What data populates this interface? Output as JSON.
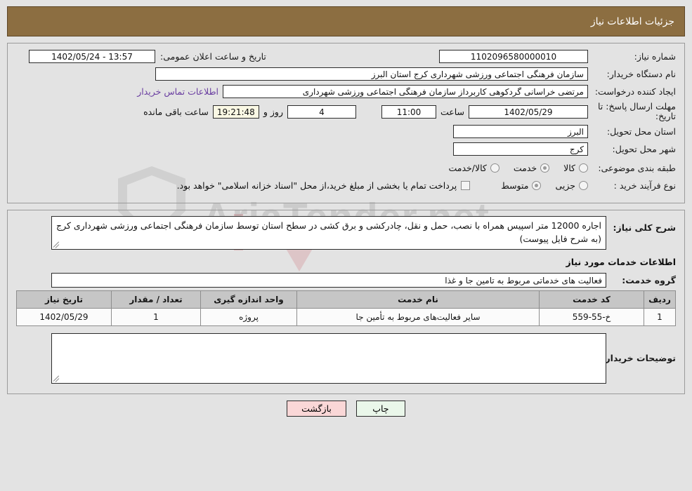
{
  "header": {
    "title": "جزئیات اطلاعات نیاز"
  },
  "watermark": {
    "text": "AriaTender.net"
  },
  "form": {
    "need_number_label": "شماره نیاز:",
    "need_number_value": "1102096580000010",
    "announce_label": "تاریخ و ساعت اعلان عمومی:",
    "announce_value": "13:57 - 1402/05/24",
    "buyer_org_label": "نام دستگاه خریدار:",
    "buyer_org_value": "سازمان فرهنگی اجتماعی ورزشی شهرداری کرج استان البرز",
    "creator_label": "ایجاد کننده درخواست:",
    "creator_value": "مرتضی خراسانی گردکوهی کاربرداز سازمان فرهنگی اجتماعی ورزشی شهرداری",
    "contact_link": "اطلاعات تماس خریدار",
    "deadline_label": "مهلت ارسال پاسخ: تا تاریخ:",
    "deadline_date": "1402/05/29",
    "hour_label": "ساعت",
    "deadline_hour": "11:00",
    "days_value": "4",
    "days_label": "روز و",
    "countdown_value": "19:21:48",
    "remaining_label": "ساعت باقی مانده",
    "province_label": "استان محل تحویل:",
    "province_value": "البرز",
    "city_label": "شهر محل تحویل:",
    "city_value": "کرج",
    "category_label": "طبقه بندی موضوعی:",
    "category_options": [
      {
        "label": "کالا",
        "selected": false
      },
      {
        "label": "خدمت",
        "selected": true
      },
      {
        "label": "کالا/خدمت",
        "selected": false
      }
    ],
    "process_label": "نوع فرآیند خرید :",
    "process_options": [
      {
        "label": "جزیی",
        "selected": false
      },
      {
        "label": "متوسط",
        "selected": true
      }
    ],
    "treasury_checkbox_text": "پرداخت تمام یا بخشی از مبلغ خرید،از محل \"اسناد خزانه اسلامی\" خواهد بود.",
    "treasury_checked": false
  },
  "description": {
    "label": "شرح کلی نیاز:",
    "value": "اجاره 12000 متر اسپیس همراه با نصب، حمل و نقل، چادرکشی و برق کشی در سطح استان توسط سازمان فرهنگی اجتماعی ورزشی شهرداری کرج (به شرح فایل پیوست)"
  },
  "services": {
    "heading": "اطلاعات خدمات مورد نیاز",
    "group_label": "گروه خدمت:",
    "group_value": "فعالیت های خدماتی مربوط به تامین جا و غذا",
    "table": {
      "columns": [
        "ردیف",
        "کد خدمت",
        "نام خدمت",
        "واحد اندازه گیری",
        "تعداد / مقدار",
        "تاریخ نیاز"
      ],
      "rows": [
        {
          "row": "1",
          "code": "خ-55-559",
          "name": "سایر فعالیت‌های مربوط به تأمین جا",
          "unit": "پروژه",
          "qty": "1",
          "date": "1402/05/29"
        }
      ]
    }
  },
  "buyer_notes": {
    "label": "توضیحات خریدار:",
    "value": ""
  },
  "footer": {
    "print_label": "چاپ",
    "back_label": "بازگشت"
  },
  "colors": {
    "header_bg": "#8c6e41",
    "page_bg": "#e3e3e3",
    "link": "#6a3ea1",
    "table_header_bg": "#c6c6c6",
    "print_btn_bg": "#eaf7ea",
    "back_btn_bg": "#fad7d7",
    "countdown_bg": "#faf8e4"
  }
}
